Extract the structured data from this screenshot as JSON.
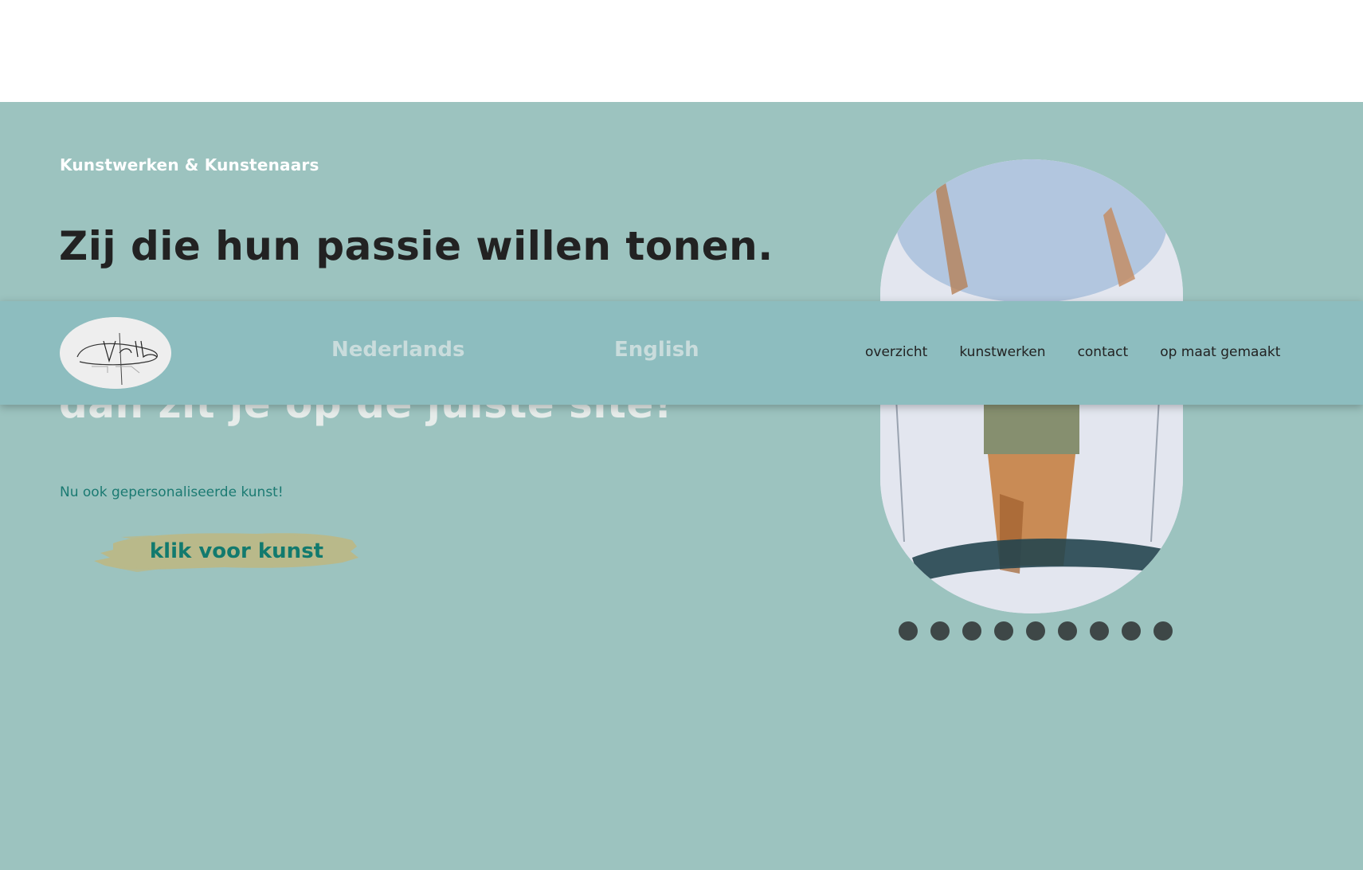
{
  "hero": {
    "eyebrow": "Kunstwerken & Kunstenaars",
    "headline": "Zij die hun passie willen tonen.",
    "headline_partial": "dan zit je op de juiste site!",
    "subtext": "Nu ook gepersonaliseerde kunst!",
    "cta_label": "klik voor kunst"
  },
  "slider": {
    "dot_count": 9
  },
  "nav": {
    "languages": [
      "Nederlands",
      "English"
    ],
    "links": [
      "overzicht",
      "kunstwerken",
      "contact",
      "op maat gemaakt"
    ]
  },
  "colors": {
    "hero_bg": "#9cc3bf",
    "navbar_bg": "#8dbdbf",
    "cta_brush": "#b9b98a",
    "cta_text": "#127a6e",
    "dot": "#3e4747"
  }
}
